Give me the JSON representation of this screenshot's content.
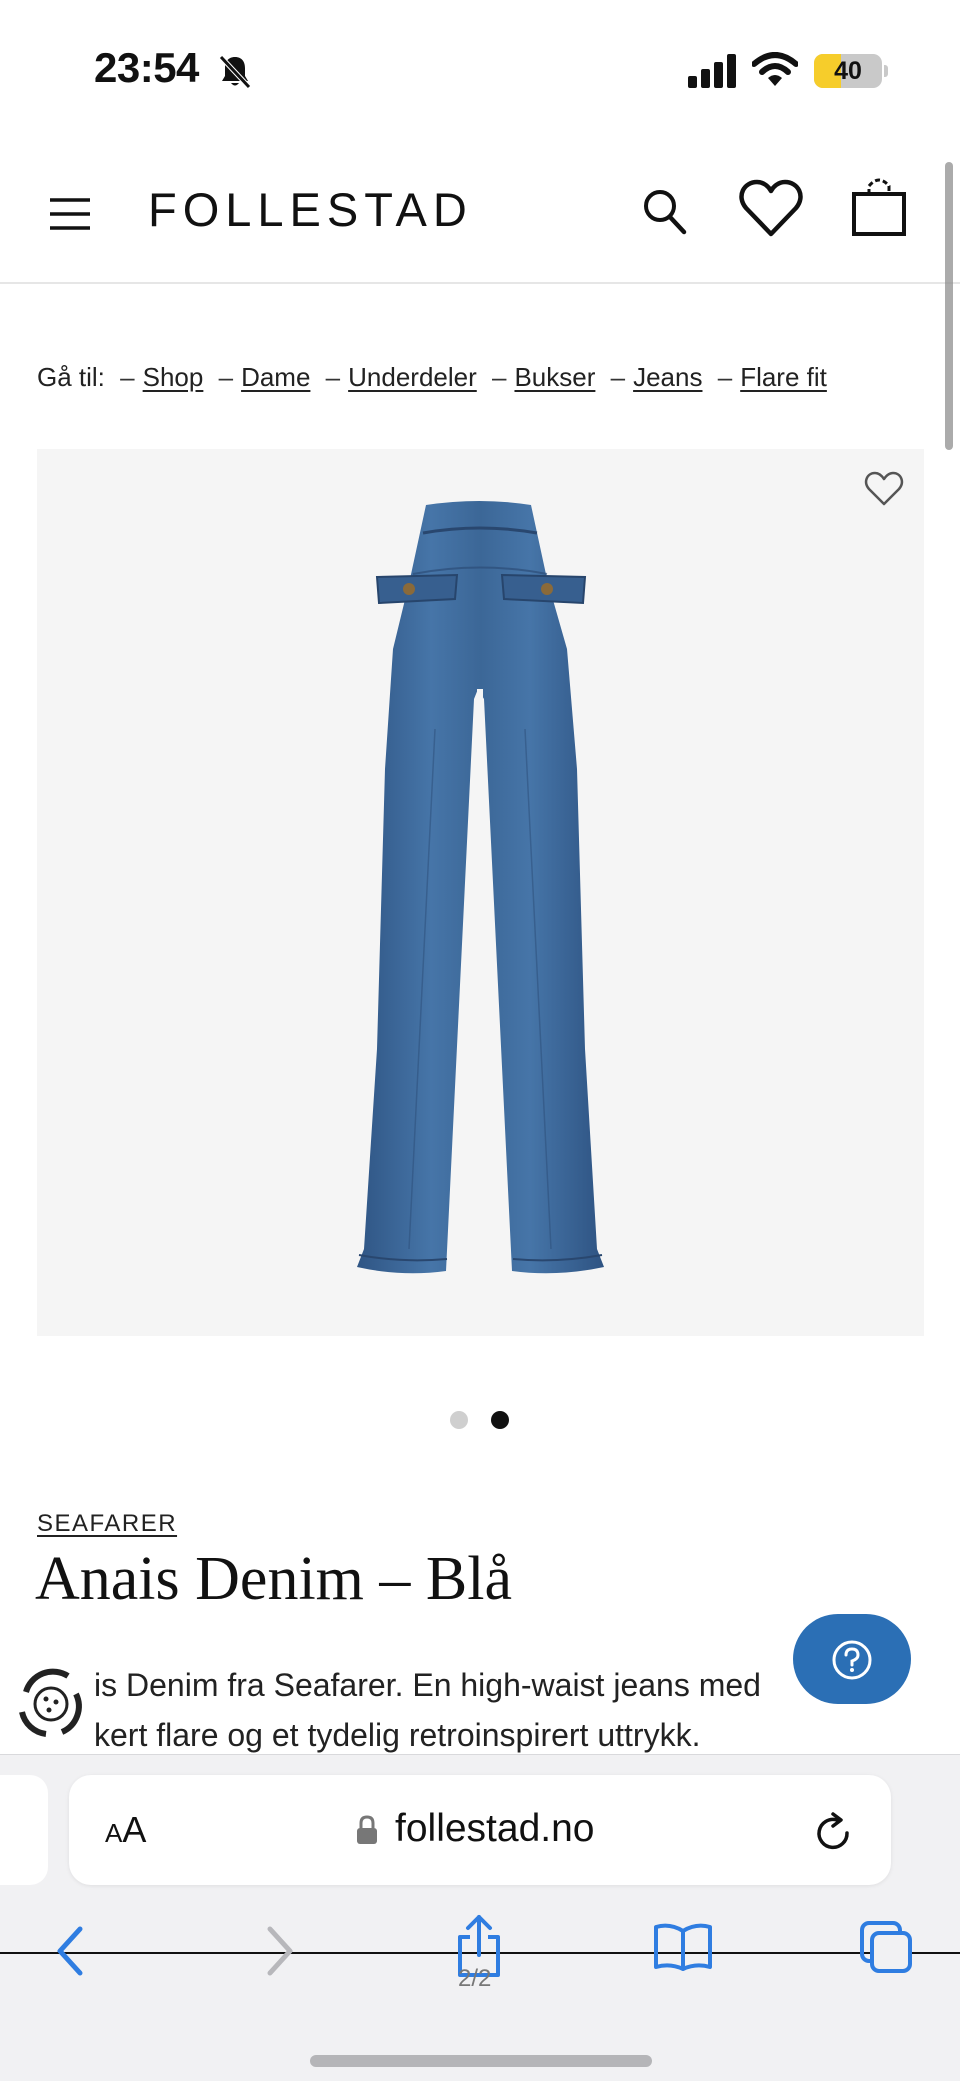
{
  "status_bar": {
    "time": "23:54",
    "battery_level": "40",
    "battery_fraction": 0.4,
    "icons": [
      "bell-slash-icon",
      "signal-icon",
      "wifi-icon",
      "battery-icon"
    ]
  },
  "header": {
    "logo": "FOLLESTAD",
    "icons": [
      "menu-icon",
      "search-icon",
      "heart-icon",
      "shopping-bag-icon"
    ]
  },
  "breadcrumb": {
    "prefix": "Gå til:",
    "separator": "–",
    "items": [
      "Shop",
      "Dame",
      "Underdeler",
      "Bukser",
      "Jeans",
      "Flare fit"
    ]
  },
  "product": {
    "image_alt_icon": "jeans-image",
    "wishlist_icon": "heart-outline-icon",
    "carousel": {
      "count": 2,
      "active": 2
    },
    "brand": "SEAFARER",
    "title": "Anais Denim – Blå",
    "description_lines": [
      "is Denim fra Seafarer. En high-waist jeans med",
      "kert flare og et tydelig retroinspirert uttrykk."
    ]
  },
  "widgets": {
    "help_icon": "question-circle-icon",
    "cookie_icon": "cookie-settings-icon"
  },
  "browser": {
    "text_size_label_small": "A",
    "text_size_label_large": "A",
    "url": "follestad.no",
    "page_indicator": "2/2",
    "toolbar_icons": [
      "back-icon",
      "forward-icon",
      "share-icon",
      "bookmarks-icon",
      "tabs-icon"
    ]
  },
  "colors": {
    "help_button": "#2b6fb5",
    "battery": "#f6cd2b",
    "denim": "#3f6a9c",
    "toolbar_accent": "#2f7de1"
  }
}
